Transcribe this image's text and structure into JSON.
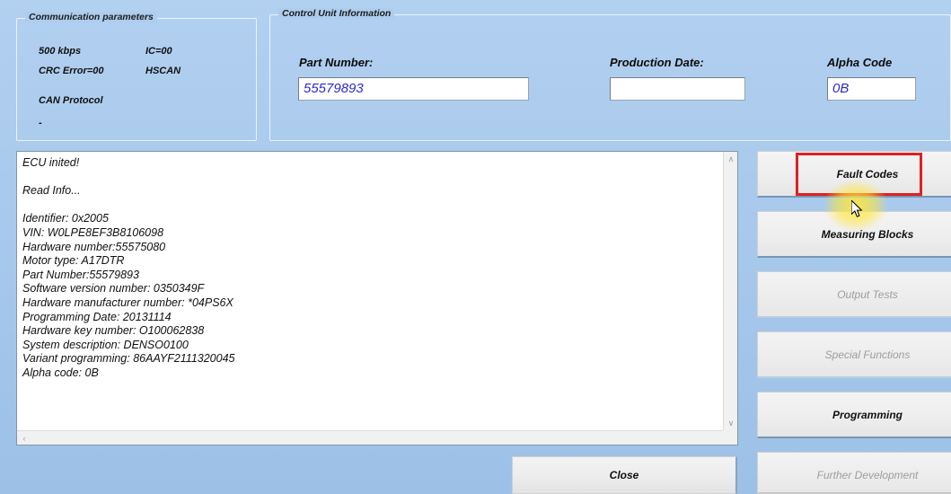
{
  "communication_panel": {
    "title": "Communication parameters",
    "rows": [
      {
        "left": "500 kbps",
        "right": "IC=00"
      },
      {
        "left": "CRC Error=00",
        "right": "HSCAN"
      }
    ],
    "protocol_label": "CAN Protocol",
    "protocol_value": "-"
  },
  "control_unit_panel": {
    "title": "Control Unit Information",
    "fields": [
      {
        "label": "Part Number:",
        "value": "55579893",
        "placeholder": ""
      },
      {
        "label": "Production Date:",
        "value": "",
        "placeholder": ""
      },
      {
        "label": "Alpha Code",
        "value": "0B",
        "placeholder": ""
      }
    ]
  },
  "log": {
    "text": "ECU inited!\n\nRead Info...\n\nIdentifier: 0x2005\nVIN: W0LPE8EF3B8106098\nHardware number:55575080\nMotor type: A17DTR\nPart Number:55579893\nSoftware version number: 0350349F\nHardware manufacturer number: *04PS6X\nProgramming Date: 20131114\nHardware key number: O100062838\nSystem description: DENSO0100\nVariant programming: 86AAYF2111320045\nAlpha code: 0B",
    "scroll_up_glyph": "∧",
    "scroll_down_glyph": "∨",
    "scroll_left_glyph": "‹",
    "scroll_right_glyph": "›"
  },
  "side_buttons": [
    {
      "label": "Fault Codes",
      "enabled": true,
      "highlighted": true
    },
    {
      "label": "Measuring Blocks",
      "enabled": true,
      "highlighted": false
    },
    {
      "label": "Output Tests",
      "enabled": false,
      "highlighted": false
    },
    {
      "label": "Special Functions",
      "enabled": false,
      "highlighted": false
    },
    {
      "label": "Programming",
      "enabled": true,
      "highlighted": false
    },
    {
      "label": "Further Development",
      "enabled": false,
      "highlighted": false
    }
  ],
  "footer": {
    "close_label": "Close"
  },
  "colors": {
    "background": "#a8c9ec",
    "highlight_box": "#e02020",
    "input_text": "#2a2ad0",
    "click_glow": "#ffe63c"
  }
}
